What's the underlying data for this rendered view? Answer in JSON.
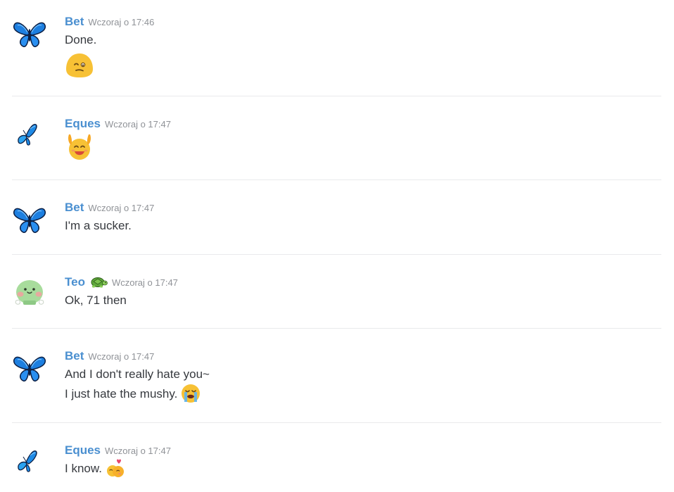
{
  "messages": [
    {
      "author": "Bet",
      "avatar_icon": "blue-butterfly-icon",
      "timestamp": "Wczoraj o 17:46",
      "lines": [
        "Done."
      ],
      "emoji": "thinking-face-emoji"
    },
    {
      "author": "Eques",
      "avatar_icon": "small-butterfly-icon",
      "timestamp": "Wczoraj o 17:47",
      "lines": [],
      "emoji": "raised-hands-happy-emoji"
    },
    {
      "author": "Bet",
      "avatar_icon": "blue-butterfly-icon",
      "timestamp": "Wczoraj o 17:47",
      "lines": [
        "I'm a sucker."
      ]
    },
    {
      "author": "Teo",
      "avatar_icon": "green-blob-icon",
      "author_badge": "turtle-emoji",
      "timestamp": "Wczoraj o 17:47",
      "lines": [
        "Ok, 71 then"
      ]
    },
    {
      "author": "Bet",
      "avatar_icon": "blue-butterfly-icon",
      "timestamp": "Wczoraj o 17:47",
      "lines": [
        "And I don't really hate you~",
        "I just hate the mushy."
      ],
      "line_emoji": "crying-face-emoji"
    },
    {
      "author": "Eques",
      "avatar_icon": "small-butterfly-icon",
      "timestamp": "Wczoraj o 17:47",
      "lines": [
        "I know."
      ],
      "line_emoji": "hugging-heart-emoji"
    }
  ],
  "colors": {
    "username": "#4a8fd0",
    "timestamp": "#8f9297",
    "text": "#36393e",
    "separator": "#e9eaec",
    "emoji_yellow": "#f7c135"
  }
}
